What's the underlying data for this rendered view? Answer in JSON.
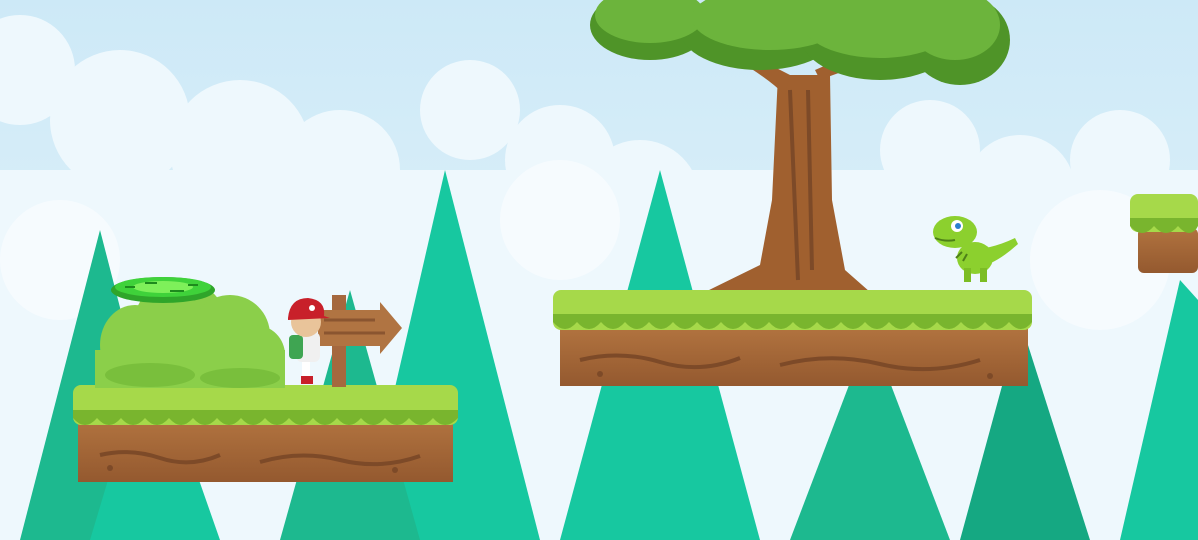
{
  "game": {
    "background": {
      "sky_top": "#dff1fb",
      "sky_bottom": "#bfe6f6",
      "cloud": "#e9f6fc"
    },
    "colors": {
      "tree_near": "#17c8a0",
      "tree_mid": "#1db98f",
      "tree_dark": "#15a882",
      "grass_light": "#a6d94a",
      "grass_dark": "#79b52e",
      "dirt": "#a5683e",
      "dirt_dark": "#7d4a28",
      "trunk": "#a0602f",
      "leaf": "#6cb43c",
      "leaf_dark": "#4f9428",
      "bush": "#8bcf4a",
      "portal": "#3fd23a",
      "sign": "#a5683e",
      "player_cap": "#c8202a",
      "player_backpack": "#3fa552",
      "dino": "#8cd02e"
    },
    "entities": [
      {
        "name": "player",
        "icon": "boy-with-red-cap-sprite"
      },
      {
        "name": "enemy",
        "icon": "green-dinosaur-sprite"
      },
      {
        "name": "portal",
        "icon": "green-warp-pad"
      },
      {
        "name": "signpost",
        "icon": "arrow-right-signpost"
      }
    ]
  }
}
